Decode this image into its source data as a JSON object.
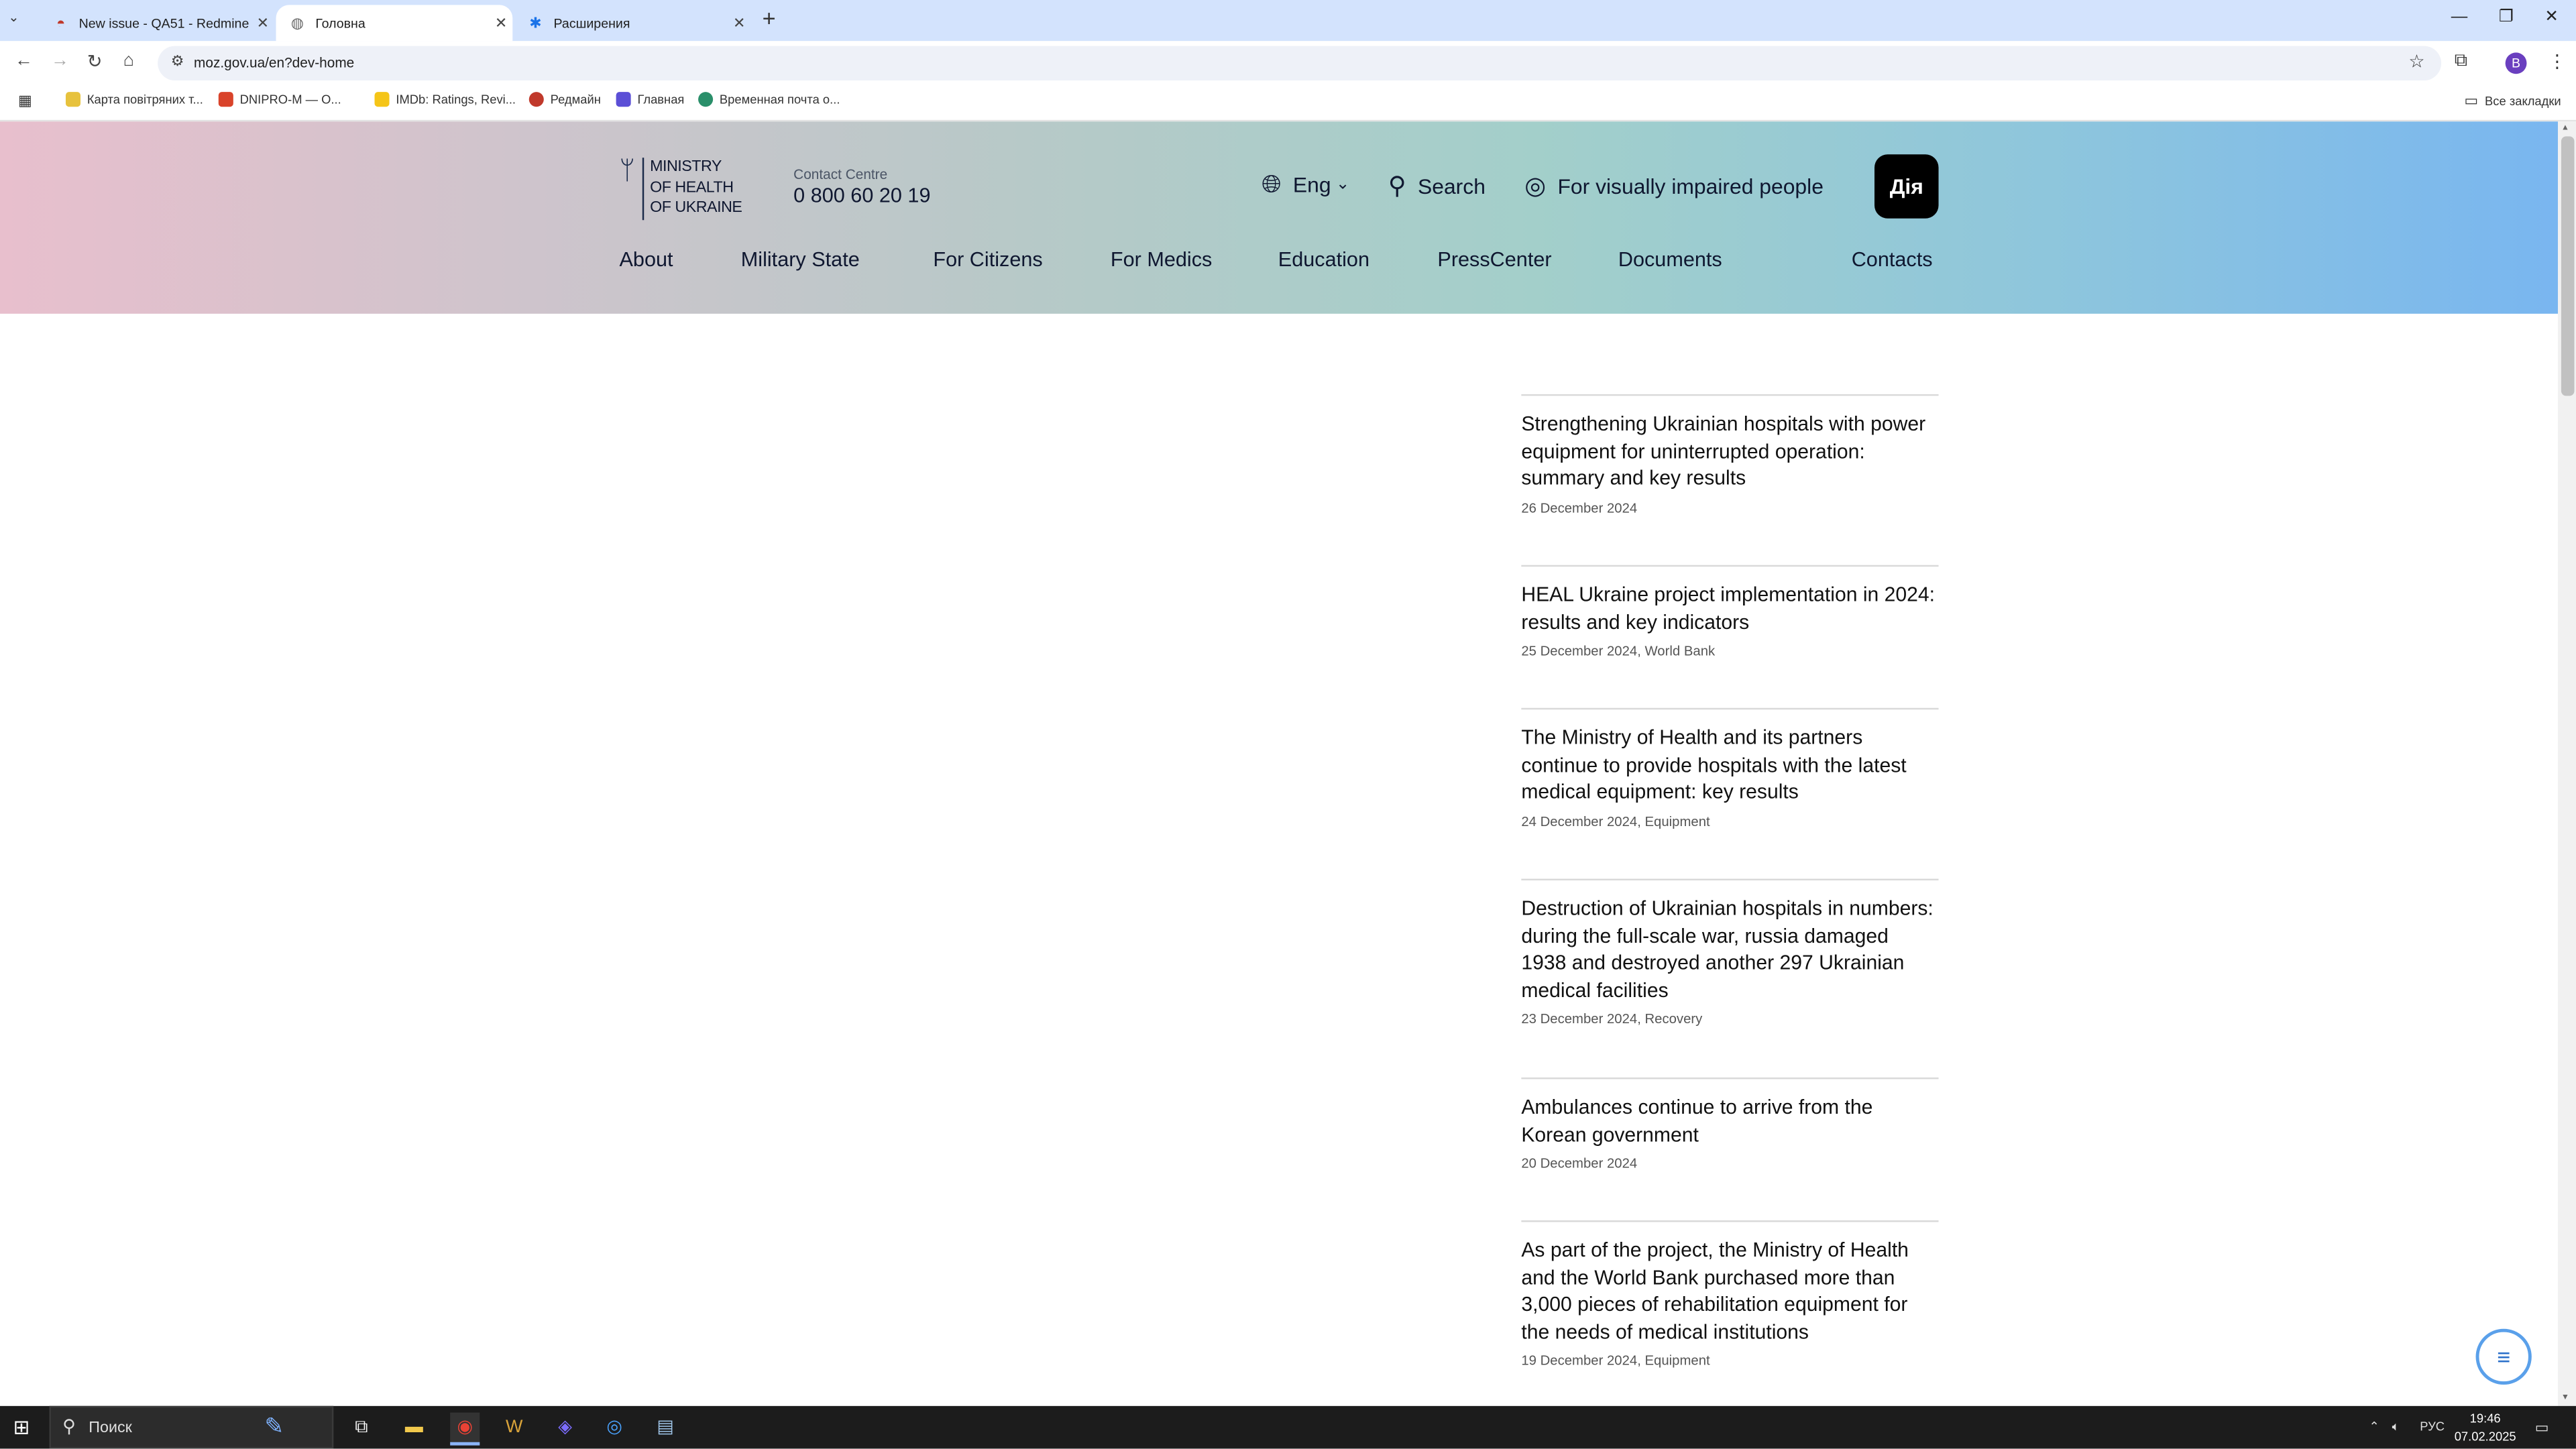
{
  "browser": {
    "tabs": [
      {
        "title": "New issue - QA51 - Redmine",
        "icon": "redmine-icon"
      },
      {
        "title": "Головна",
        "icon": "globe-icon"
      },
      {
        "title": "Расширения",
        "icon": "puzzle-icon"
      }
    ],
    "url": "moz.gov.ua/en?dev-home",
    "profile_initial": "B",
    "bookmarks": [
      {
        "label": "Карта повітряних т..."
      },
      {
        "label": "DNIPRO-M — О..."
      },
      {
        "label": "IMDb: Ratings, Revi..."
      },
      {
        "label": "Редмайн"
      },
      {
        "label": "Главная"
      },
      {
        "label": "Временная почта о..."
      }
    ],
    "all_bookmarks": "Все закладки"
  },
  "site": {
    "logo_lines": [
      "Ministry",
      "of Health",
      "of Ukraine"
    ],
    "contact_label": "Contact Centre",
    "contact_phone": "0 800 60 20 19",
    "language": "Eng",
    "search_label": "Search",
    "accessibility_label": "For visually impaired people",
    "diia_label": "Дія",
    "nav": [
      "About",
      "Military State",
      "For Citizens",
      "For Medics",
      "Education",
      "PressCenter",
      "Documents",
      "Contacts"
    ]
  },
  "news": [
    {
      "title": "Strengthening Ukrainian hospitals with power equipment for uninterrupted operation: summary and key results",
      "meta": "26 December 2024"
    },
    {
      "title": "HEAL Ukraine project implementation in 2024: results and key indicators",
      "meta": "25 December 2024, World Bank"
    },
    {
      "title": "The Ministry of Health and its partners continue to provide hospitals with the latest medical equipment: key results",
      "meta": "24 December 2024, Equipment"
    },
    {
      "title": "Destruction of Ukrainian hospitals in numbers: during the full-scale war, russia damaged 1938 and destroyed another 297 Ukrainian medical facilities",
      "meta": "23 December 2024, Recovery"
    },
    {
      "title": "Ambulances continue to arrive from the Korean government",
      "meta": "20 December 2024"
    },
    {
      "title": "As part of the project, the Ministry of Health and the World Bank purchased more than 3,000 pieces of rehabilitation equipment for the needs of medical institutions",
      "meta": "19 December 2024, Equipment"
    }
  ],
  "taskbar": {
    "search_placeholder": "Поиск",
    "language": "РУС",
    "time": "19:46",
    "date": "07.02.2025"
  },
  "colors": {
    "header_gradient_start": "#e8bfcd",
    "header_gradient_end": "#79b6f0",
    "diia_button": "#000000",
    "tabstrip": "#d3e3fd"
  }
}
